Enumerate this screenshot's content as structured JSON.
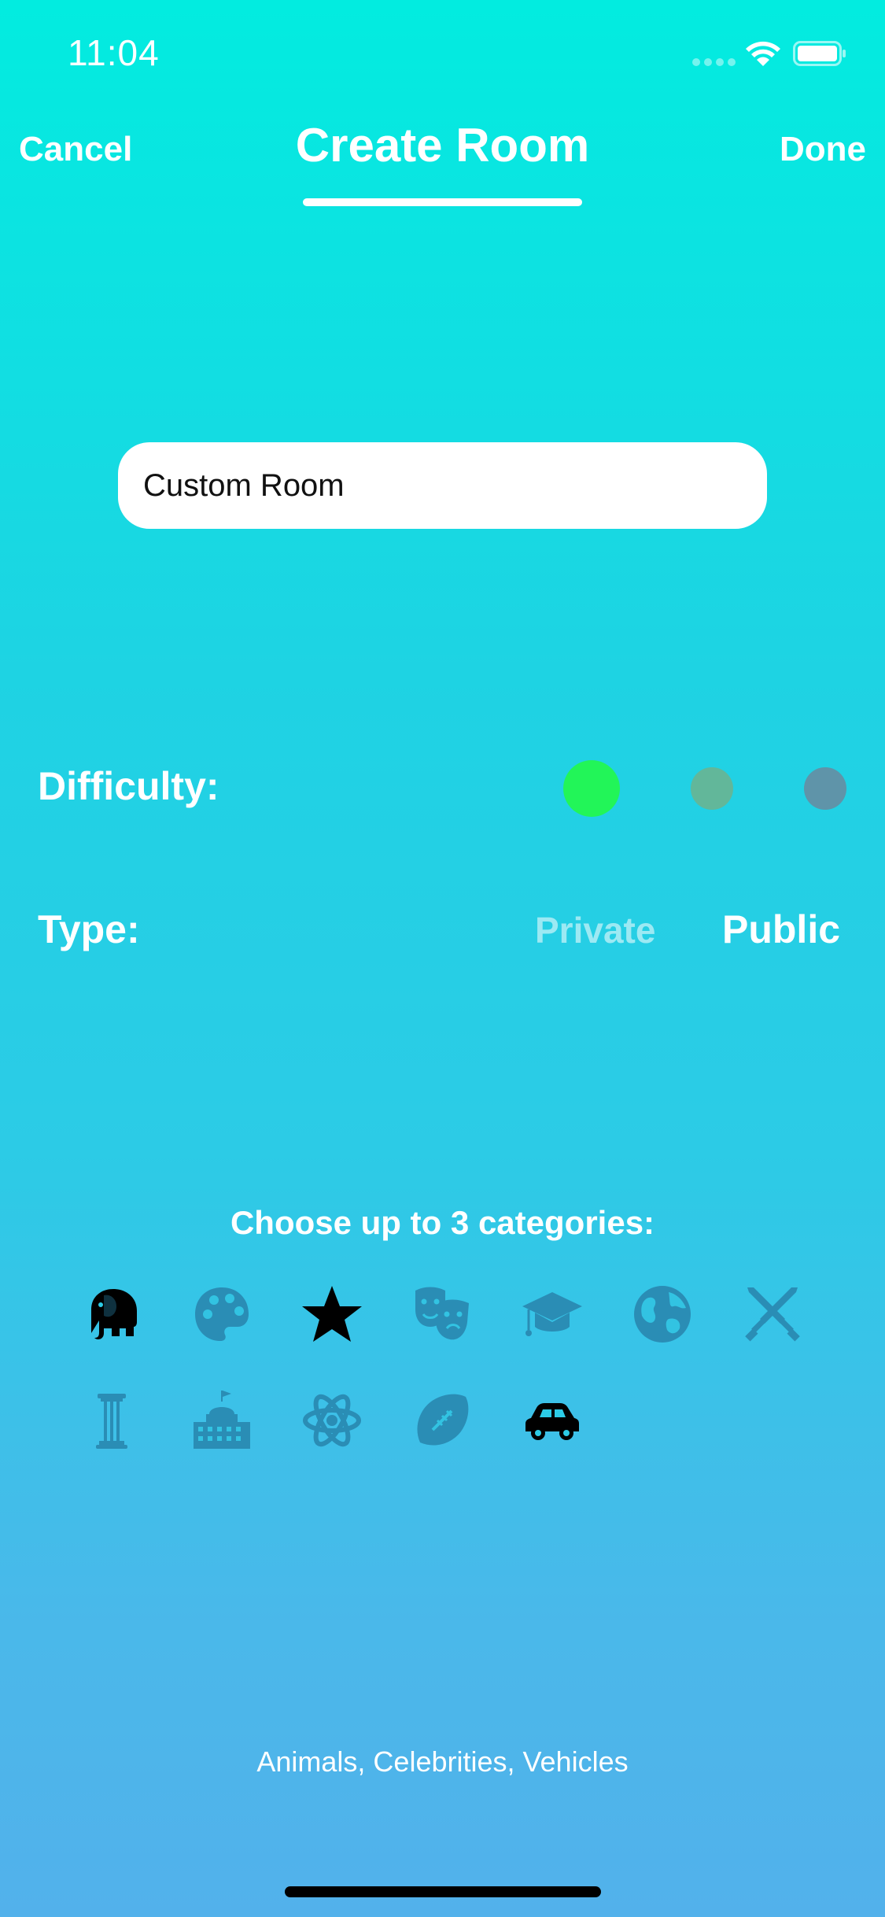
{
  "status_bar": {
    "time": "11:04"
  },
  "nav": {
    "cancel_label": "Cancel",
    "title": "Create Room",
    "done_label": "Done"
  },
  "room": {
    "name_value": "Custom Room"
  },
  "difficulty": {
    "label": "Difficulty:",
    "levels": [
      {
        "color": "#22f558",
        "selected": true
      },
      {
        "color": "#62b79a",
        "selected": false
      },
      {
        "color": "#5f94a9",
        "selected": false
      }
    ]
  },
  "type": {
    "label": "Type:",
    "options": [
      "Private",
      "Public"
    ],
    "selected": "Public"
  },
  "categories": {
    "heading": "Choose up to 3 categories:",
    "items": [
      {
        "icon": "elephant-icon",
        "selected": true
      },
      {
        "icon": "palette-icon",
        "selected": false
      },
      {
        "icon": "star-icon",
        "selected": true
      },
      {
        "icon": "theater-masks-icon",
        "selected": false
      },
      {
        "icon": "graduation-cap-icon",
        "selected": false
      },
      {
        "icon": "globe-icon",
        "selected": false
      },
      {
        "icon": "crossed-swords-icon",
        "selected": false
      },
      {
        "icon": "column-icon",
        "selected": false
      },
      {
        "icon": "government-building-icon",
        "selected": false
      },
      {
        "icon": "atom-icon",
        "selected": false
      },
      {
        "icon": "football-icon",
        "selected": false
      },
      {
        "icon": "car-icon",
        "selected": true
      }
    ],
    "selected_text": "Animals, Celebrities, Vehicles"
  },
  "colors": {
    "selected_icon": "#000000",
    "unselected_icon": "#2a8db5"
  }
}
